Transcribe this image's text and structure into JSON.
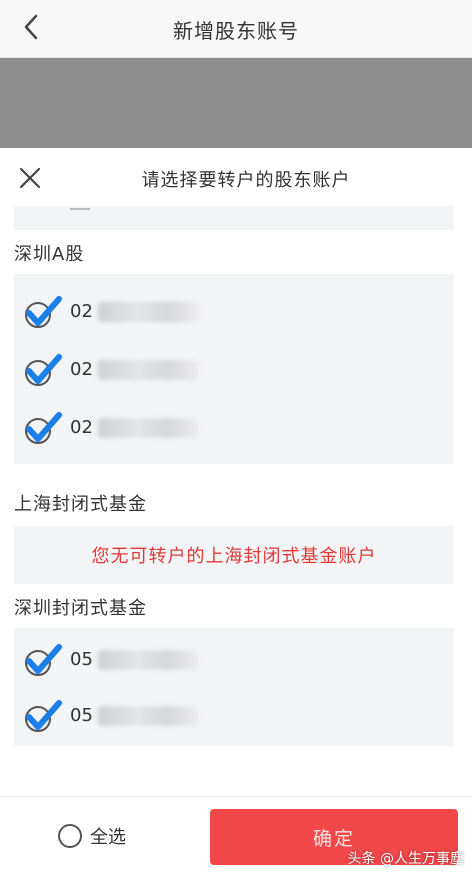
{
  "header": {
    "title": "新增股东账号",
    "back_icon": "chevron-left-icon"
  },
  "sheet": {
    "title": "请选择要转户的股东账户",
    "close_icon": "close-icon",
    "sections": [
      {
        "label": "深圳A股",
        "accounts": [
          {
            "prefix": "02",
            "checked": true
          },
          {
            "prefix": "02",
            "checked": true
          },
          {
            "prefix": "02",
            "checked": true
          }
        ]
      },
      {
        "label": "上海封闭式基金",
        "notice": "您无可转户的上海封闭式基金账户"
      },
      {
        "label": "深圳封闭式基金",
        "accounts": [
          {
            "prefix": "05",
            "checked": true
          },
          {
            "prefix": "05",
            "checked": true
          }
        ]
      }
    ]
  },
  "footer": {
    "select_all_label": "全选",
    "select_all_checked": false,
    "confirm_label": "确定"
  },
  "watermark": "头条 @人生万事塵",
  "colors": {
    "accent_blue": "#1a7fe6",
    "confirm_red": "#f2484a",
    "notice_red": "#e03838",
    "overlay_gray": "#8e8e8e"
  }
}
